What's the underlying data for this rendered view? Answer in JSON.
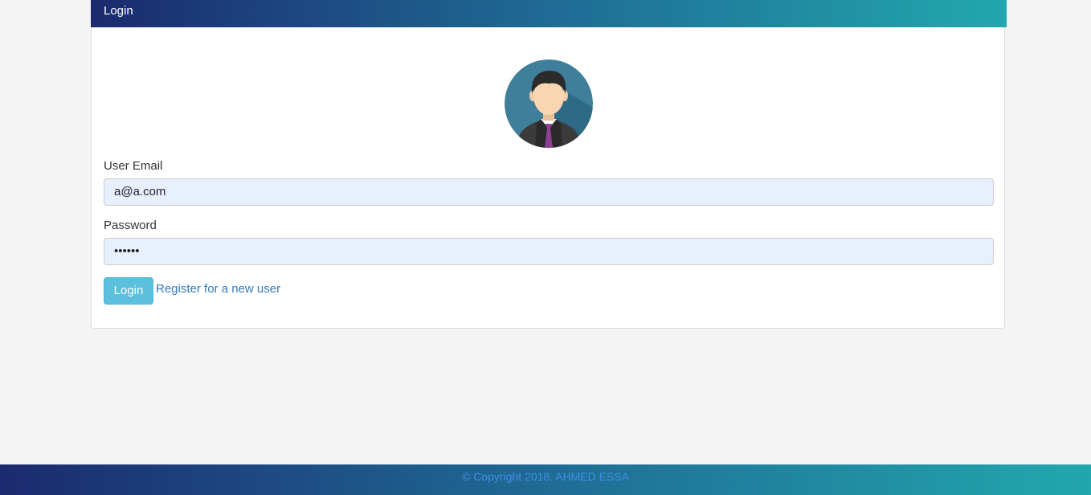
{
  "panel": {
    "title": "Login"
  },
  "avatar": {
    "icon": "user-avatar-icon"
  },
  "form": {
    "email_label": "User Email",
    "email_value": "a@a.com",
    "password_label": "Password",
    "password_value": "••••••",
    "login_button": "Login",
    "register_link": "Register for a new user"
  },
  "footer": {
    "copyright": "© Copyright 2018. AHMED ESSA"
  },
  "colors": {
    "gradient_start": "#1b2a6e",
    "gradient_end": "#22a7ae",
    "button": "#5bc0de",
    "link": "#337ab7",
    "input_bg": "#e8f0fe"
  }
}
